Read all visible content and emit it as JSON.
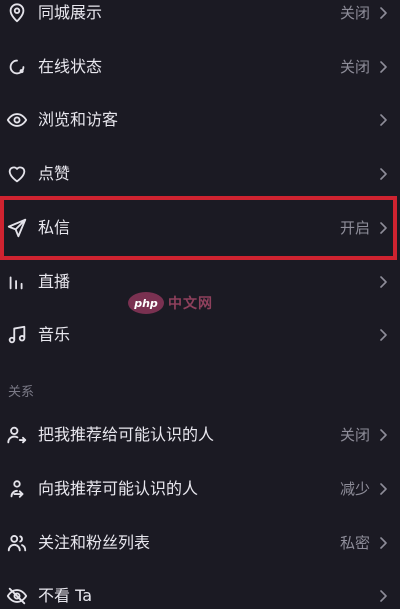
{
  "settings": {
    "rows": [
      {
        "id": "city_display",
        "label": "同城展示",
        "value": "关闭",
        "icon": "location-pin-icon"
      },
      {
        "id": "online_status",
        "label": "在线状态",
        "value": "关闭",
        "icon": "online-status-icon"
      },
      {
        "id": "browse_visitors",
        "label": "浏览和访客",
        "value": "",
        "icon": "eye-icon"
      },
      {
        "id": "likes",
        "label": "点赞",
        "value": "",
        "icon": "heart-icon"
      },
      {
        "id": "messages",
        "label": "私信",
        "value": "开启",
        "icon": "paper-plane-icon"
      },
      {
        "id": "live",
        "label": "直播",
        "value": "",
        "icon": "live-bars-icon"
      },
      {
        "id": "music",
        "label": "音乐",
        "value": "",
        "icon": "music-note-icon"
      }
    ]
  },
  "relations": {
    "section_title": "关系",
    "rows": [
      {
        "id": "recommend_me",
        "label": "把我推荐给可能认识的人",
        "value": "关闭",
        "icon": "user-share-icon"
      },
      {
        "id": "recommend_to_me",
        "label": "向我推荐可能认识的人",
        "value": "减少",
        "icon": "user-link-icon"
      },
      {
        "id": "follow_list",
        "label": "关注和粉丝列表",
        "value": "私密",
        "icon": "users-icon"
      },
      {
        "id": "hide_ta",
        "label": "不看 Ta",
        "value": "",
        "icon": "eye-off-icon"
      }
    ]
  },
  "watermark": {
    "badge": "php",
    "text": "中文网"
  },
  "colors": {
    "background": "#1b1a23",
    "text": "#e8e7ee",
    "secondary_text": "#8e8d99",
    "highlight": "#cf2330"
  }
}
